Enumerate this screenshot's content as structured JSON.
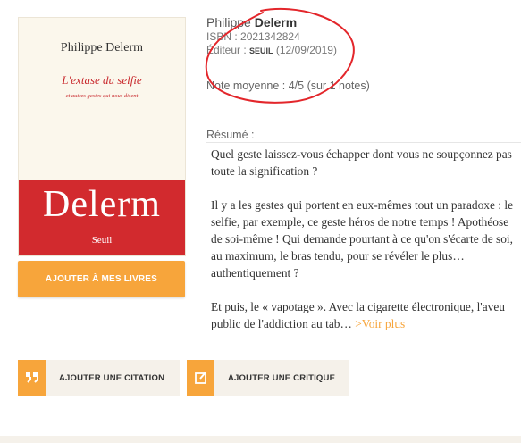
{
  "cover": {
    "author": "Philippe Delerm",
    "title": "L'extase du selfie",
    "subtitle": "et autres gestes qui nous disent",
    "big_name": "Delerm",
    "publisher": "Seuil",
    "band_color": "#d22a2e"
  },
  "actions": {
    "add_books": "Ajouter à mes livres",
    "add_quote": "Ajouter une citation",
    "add_review": "Ajouter une critique",
    "quote_icon": "quote-icon",
    "review_icon": "edit-icon"
  },
  "book": {
    "author_first": "Philippe ",
    "author_last": "Delerm",
    "isbn_label": "ISBN : ",
    "isbn": "2021342824",
    "editeur_label": "Éditeur : ",
    "publisher": "SEUIL",
    "date": "(12/09/2019)",
    "note": "Note moyenne : 4/5 (sur 1 notes)",
    "resume_label": "Résumé :"
  },
  "summary": {
    "p1": "Quel geste laissez-vous échapper dont vous ne soupçonnez pas toute la signification ?",
    "p2": "Il y a les gestes qui portent en eux-mêmes tout un paradoxe : le selfie, par exemple, ce geste héros de notre temps ! Apothéose de soi-même ! Qui demande pourtant à ce qu'on s'écarte de soi, au maximum, le bras tendu, pour se révéler le plus… authentiquement ?",
    "p3": "Et puis, le « vapotage ». Avec la cigarette électronique, l'aveu public de l'addiction au tab…",
    "more": " >Voir plus"
  },
  "colors": {
    "accent": "#f7a53b",
    "annotation": "#e3262b",
    "button_bg": "#f5f1ea"
  }
}
